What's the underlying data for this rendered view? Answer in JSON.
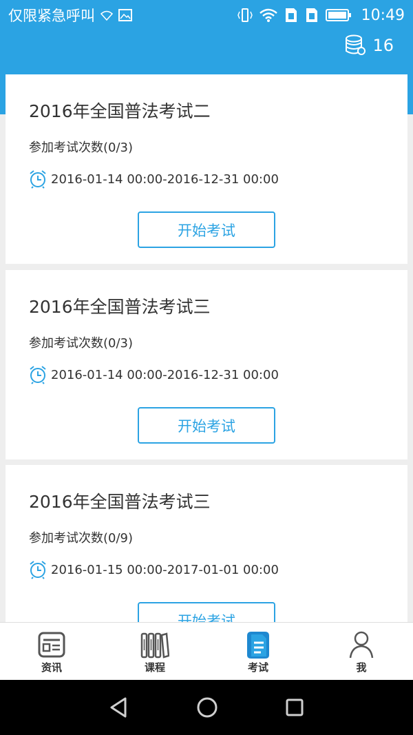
{
  "status_bar": {
    "carrier": "仅限紧急呼叫",
    "time": "10:49"
  },
  "header": {
    "coins": "16"
  },
  "exams": [
    {
      "title": "2016年全国普法考试二",
      "attempts": "参加考试次数(0/3)",
      "time_range": "2016-01-14 00:00-2016-12-31 00:00",
      "button": "开始考试"
    },
    {
      "title": "2016年全国普法考试三",
      "attempts": "参加考试次数(0/3)",
      "time_range": "2016-01-14 00:00-2016-12-31 00:00",
      "button": "开始考试"
    },
    {
      "title": "2016年全国普法考试三",
      "attempts": "参加考试次数(0/9)",
      "time_range": "2016-01-15 00:00-2017-01-01 00:00",
      "button": "开始考试"
    }
  ],
  "tabs": [
    {
      "label": "资讯",
      "icon": "news-icon"
    },
    {
      "label": "课程",
      "icon": "books-icon"
    },
    {
      "label": "考试",
      "icon": "exam-icon",
      "active": true
    },
    {
      "label": "我",
      "icon": "person-icon"
    }
  ],
  "colors": {
    "accent": "#2ba3e3",
    "background": "#eeeeee"
  }
}
